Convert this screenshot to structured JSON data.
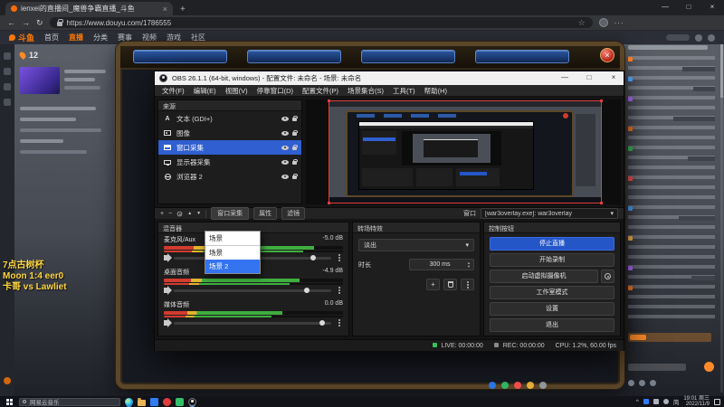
{
  "glyphs": {
    "back": "←",
    "forward": "→",
    "refresh": "↻",
    "star": "☆",
    "dots": "···",
    "newtab": "+",
    "close": "×",
    "min": "—",
    "max": "□",
    "plus": "+",
    "minus": "−",
    "up": "▲",
    "down": "▼",
    "caret": "▾",
    "chevron": "^"
  },
  "browser": {
    "tab_title": "ienxei的直播间_魔兽争霸直播_斗鱼",
    "url": "https://www.douyu.com/1786555"
  },
  "douyu": {
    "logo": "斗鱼",
    "nav": [
      "首页",
      "直播",
      "分类",
      "赛事",
      "视频",
      "游戏",
      "社区"
    ],
    "viewer_count": "12",
    "announcement": [
      "7点古树杯",
      "Moon 1:4 eer0",
      "卡哥 vs Lawliet"
    ]
  },
  "obs": {
    "title": "OBS 26.1.1 (64-bit, windows) - 配置文件: 未命名 - 场景: 未命名",
    "menu": [
      "文件(F)",
      "编辑(E)",
      "视图(V)",
      "停靠窗口(D)",
      "配置文件(P)",
      "场景集合(S)",
      "工具(T)",
      "帮助(H)"
    ],
    "sources_title": "来源",
    "sources": [
      {
        "name": "文本 (GDI+)"
      },
      {
        "name": "图像"
      },
      {
        "name": "窗口采集"
      },
      {
        "name": "显示器采集"
      },
      {
        "name": "浏览器 2"
      }
    ],
    "toolbar": {
      "source_chip": "窗口采集",
      "properties": "属性",
      "filters": "滤镜",
      "window_label": "窗口",
      "window_value": "[war3overlay.exe]: war3overlay"
    },
    "mixer": {
      "title": "混音器",
      "channels": [
        {
          "name": "麦克风/Aux",
          "db": "-5.0 dB"
        },
        {
          "name": "桌面音频",
          "db": "-4.9 dB"
        },
        {
          "name": "媒体音频",
          "db": "0.0 dB"
        }
      ]
    },
    "dropdown": {
      "value": "场景",
      "options": [
        "场景",
        "场景 2"
      ]
    },
    "transitions": {
      "title": "转场特效",
      "type": "淡出",
      "duration_label": "时长",
      "duration": "300 ms"
    },
    "controls": {
      "title": "控制按钮",
      "buttons": [
        "停止直播",
        "开始录制",
        "启动虚拟摄像机",
        "工作室模式",
        "设置",
        "退出"
      ]
    },
    "status": {
      "live_label": "LIVE:",
      "live_time": "00:00:00",
      "rec_label": "REC:",
      "rec_time": "00:00:00",
      "cpu": "CPU: 1.2%, 60.00 fps"
    }
  },
  "taskbar": {
    "search_text": "网易云音乐",
    "ime": "简",
    "time": "19:01 周三",
    "date": "2022/11/9"
  }
}
